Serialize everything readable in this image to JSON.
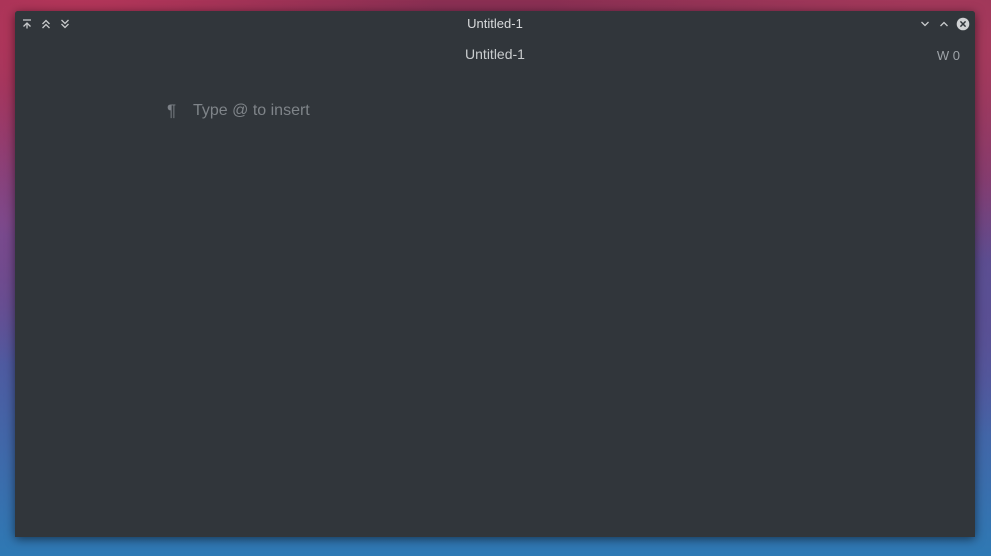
{
  "window": {
    "title": "Untitled-1"
  },
  "titlebar": {
    "left_buttons": [
      "keep-above-icon",
      "shade-up-icon",
      "shade-down-icon"
    ],
    "right_buttons": [
      "minimize-icon",
      "maximize-icon",
      "close-icon"
    ]
  },
  "document": {
    "title": "Untitled-1",
    "word_count": "W 0"
  },
  "editor": {
    "paragraph_mark": "¶",
    "value": "",
    "placeholder": "Type @ to insert"
  },
  "colors": {
    "window_bg": "#31363b",
    "text": "#d8dadc",
    "muted": "#7f8489"
  }
}
